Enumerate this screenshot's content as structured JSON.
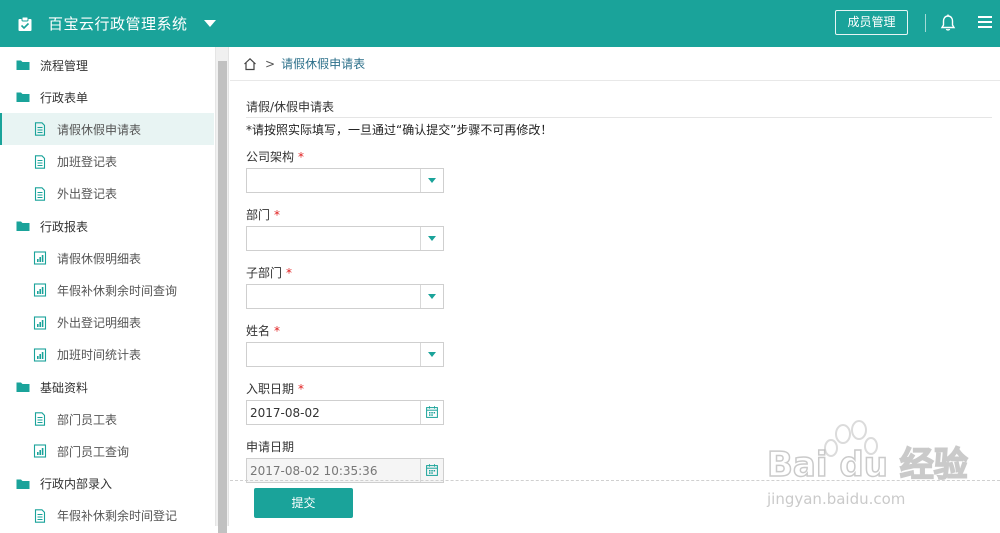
{
  "header": {
    "app_title": "百宝云行政管理系统",
    "member_button": "成员管理",
    "brand_color": "#1aa39a"
  },
  "sidebar": {
    "items": [
      {
        "label": "流程管理",
        "kind": "group",
        "icon": "folder-icon"
      },
      {
        "label": "行政表单",
        "kind": "group",
        "icon": "folder-icon"
      },
      {
        "label": "请假休假申请表",
        "kind": "child",
        "icon": "document-icon",
        "active": true
      },
      {
        "label": "加班登记表",
        "kind": "child",
        "icon": "document-icon"
      },
      {
        "label": "外出登记表",
        "kind": "child",
        "icon": "document-icon"
      },
      {
        "label": "行政报表",
        "kind": "group",
        "icon": "folder-icon"
      },
      {
        "label": "请假休假明细表",
        "kind": "child",
        "icon": "report-icon"
      },
      {
        "label": "年假补休剩余时间查询",
        "kind": "child",
        "icon": "report-icon"
      },
      {
        "label": "外出登记明细表",
        "kind": "child",
        "icon": "report-icon"
      },
      {
        "label": "加班时间统计表",
        "kind": "child",
        "icon": "report-icon"
      },
      {
        "label": "基础资料",
        "kind": "group",
        "icon": "folder-icon"
      },
      {
        "label": "部门员工表",
        "kind": "child",
        "icon": "document-icon"
      },
      {
        "label": "部门员工查询",
        "kind": "child",
        "icon": "report-icon"
      },
      {
        "label": "行政内部录入",
        "kind": "group",
        "icon": "folder-icon"
      },
      {
        "label": "年假补休剩余时间登记",
        "kind": "child",
        "icon": "document-icon"
      }
    ]
  },
  "breadcrumb": {
    "separator": ">",
    "current": "请假休假申请表"
  },
  "form": {
    "title": "请假/休假申请表",
    "notice": "*请按照实际填写，一旦通过“确认提交”步骤不可再修改！",
    "required_mark": "*",
    "fields": [
      {
        "label": "公司架构",
        "required": true,
        "type": "select",
        "value": ""
      },
      {
        "label": "部门",
        "required": true,
        "type": "select",
        "value": ""
      },
      {
        "label": "子部门",
        "required": true,
        "type": "select",
        "value": ""
      },
      {
        "label": "姓名",
        "required": true,
        "type": "select",
        "value": ""
      },
      {
        "label": "入职日期",
        "required": true,
        "type": "date",
        "value": "2017-08-02"
      },
      {
        "label": "申请日期",
        "required": false,
        "type": "datetime",
        "value": "2017-08-02 10:35:36"
      }
    ],
    "submit_label": "提交"
  },
  "watermark": {
    "text_top": "Bai du 经验",
    "text_bottom": "jingyan.baidu.com"
  }
}
